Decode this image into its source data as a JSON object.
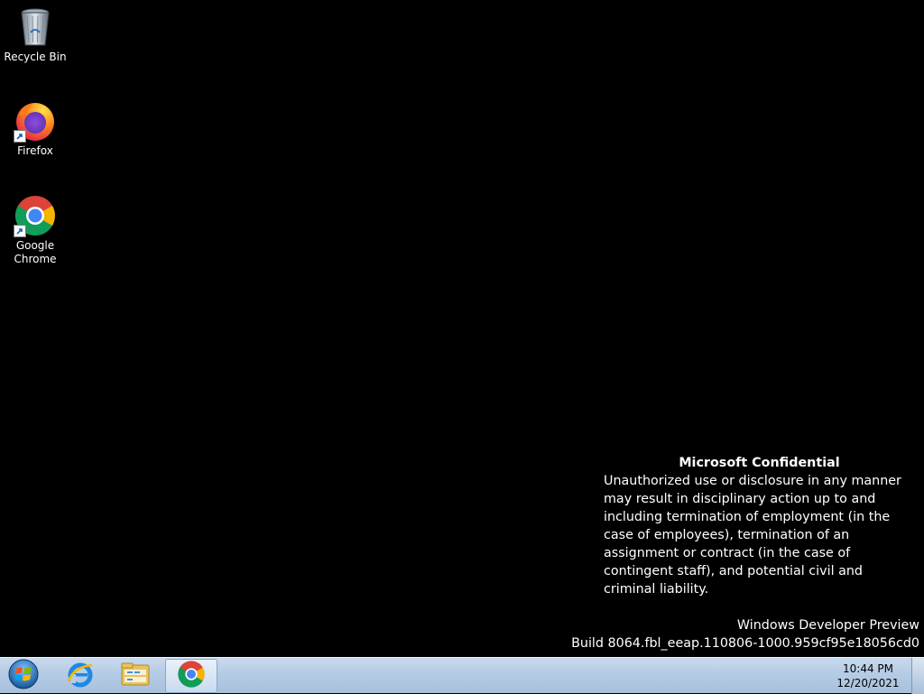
{
  "desktop": {
    "icons": [
      {
        "label": "Recycle Bin",
        "icon": "recycle-bin-icon"
      },
      {
        "label": "Firefox",
        "icon": "firefox-icon"
      },
      {
        "label": "Google Chrome",
        "icon": "chrome-icon"
      }
    ],
    "confidential": {
      "title": "Microsoft Confidential",
      "body": "Unauthorized use or disclosure in any manner may result in disciplinary action up to and including termination of employment (in the case of employees), termination of an assignment or contract (in the case of contingent staff), and potential civil and criminal liability."
    },
    "watermark": {
      "product": "Windows Developer Preview",
      "build": "Build 8064.fbl_eeap.110806-1000.959cf95e18056cd0"
    }
  },
  "taskbar": {
    "start": "start-orb-icon",
    "pinned": [
      "internet-explorer-icon",
      "file-explorer-icon",
      "chrome-icon"
    ],
    "clock": {
      "time": "10:44 PM",
      "date": "12/20/2021"
    }
  },
  "colors": {
    "desktop_bg": "#000000",
    "taskbar_bg": "#b7cde6"
  }
}
